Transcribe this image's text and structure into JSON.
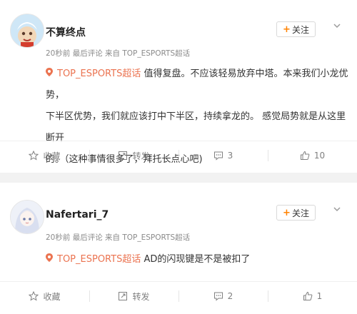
{
  "posts": [
    {
      "username": "不算终点",
      "meta": "20秒前 最后评论 来自 TOP_ESPORTS超话",
      "follow_label": "关注",
      "topic": "TOP_ESPORTS超话",
      "content_lines": [
        " 值得复盘。不应该轻易放弃中塔。本来我们小龙优势，",
        "下半区优势，我们就应该打中下半区，持续拿龙的。 感觉局势就是从这里断开",
        "的。（这种事情很多了，拜托长点心吧)"
      ],
      "actions": {
        "favorite": "收藏",
        "repost": "转发",
        "comment": "3",
        "like": "10"
      }
    },
    {
      "username": "Nafertari_7",
      "meta": "20秒前 最后评论 来自 TOP_ESPORTS超话",
      "follow_label": "关注",
      "topic": "TOP_ESPORTS超话",
      "content_lines": [
        " AD的闪现键是不是被扣了"
      ],
      "actions": {
        "favorite": "收藏",
        "repost": "转发",
        "comment": "2",
        "like": "1"
      }
    }
  ],
  "colors": {
    "accent": "#ff8200",
    "topic": "#eb7350",
    "meta": "#8a8a8a"
  }
}
